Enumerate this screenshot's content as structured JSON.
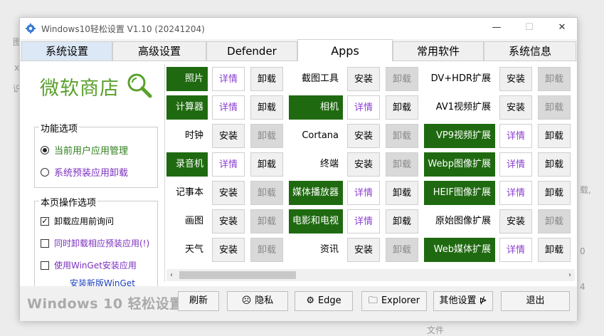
{
  "background_fragments": [
    "图",
    "x",
    "识",
    "载,",
    "0",
    "4",
    "文件"
  ],
  "window": {
    "title": "Windows10轻松设置 V1.10  (20241204)",
    "minimize": "—",
    "maximize": "☐",
    "close": "✕"
  },
  "tabs": [
    {
      "label": "系统设置"
    },
    {
      "label": "高级设置"
    },
    {
      "label": "Defender"
    },
    {
      "label": "Apps"
    },
    {
      "label": "常用软件"
    },
    {
      "label": "系统信息"
    }
  ],
  "sidebar": {
    "logo_text": "微软商店",
    "function_group": {
      "title": "功能选项",
      "options": [
        {
          "label": "当前用户应用管理",
          "selected": true
        },
        {
          "label": "系统预装应用卸载",
          "selected": false
        }
      ]
    },
    "page_group": {
      "title": "本页操作选项",
      "options": [
        {
          "label": "卸载应用前询问",
          "checked": true
        },
        {
          "label": "同时卸载相应预装应用(!)",
          "checked": false
        },
        {
          "label": "使用WinGet安装应用",
          "checked": false
        }
      ],
      "link": "安装新版WinGet"
    }
  },
  "apps": {
    "col1": [
      {
        "name": "照片",
        "installed": true
      },
      {
        "name": "计算器",
        "installed": true
      },
      {
        "name": "时钟",
        "installed": false
      },
      {
        "name": "录音机",
        "installed": true
      },
      {
        "name": "记事本",
        "installed": false
      },
      {
        "name": "画图",
        "installed": false
      },
      {
        "name": "天气",
        "installed": false
      }
    ],
    "col2": [
      {
        "name": "截图工具",
        "installed": false
      },
      {
        "name": "相机",
        "installed": true
      },
      {
        "name": "Cortana",
        "installed": false
      },
      {
        "name": "终端",
        "installed": false
      },
      {
        "name": "媒体播放器",
        "installed": true
      },
      {
        "name": "电影和电视",
        "installed": true
      },
      {
        "name": "资讯",
        "installed": false
      }
    ],
    "col3": [
      {
        "name": "DV+HDR扩展",
        "installed": false
      },
      {
        "name": "AV1视频扩展",
        "installed": false
      },
      {
        "name": "VP9视频扩展",
        "installed": true
      },
      {
        "name": "Webp图像扩展",
        "installed": true
      },
      {
        "name": "HEIF图像扩展",
        "installed": true
      },
      {
        "name": "原始图像扩展",
        "installed": false
      },
      {
        "name": "Web媒体扩展",
        "installed": true
      }
    ],
    "labels": {
      "detail": "详情",
      "install": "安装",
      "uninstall": "卸载"
    }
  },
  "scrollbar": {
    "left": "‹",
    "right": "›"
  },
  "bottom": {
    "title": "Windows 10 轻松设置",
    "buttons": [
      {
        "label": "刷新",
        "icon": ""
      },
      {
        "label": "隐私",
        "icon": "☹"
      },
      {
        "label": "Edge",
        "icon": "⚙"
      },
      {
        "label": "Explorer",
        "icon": "🗀"
      },
      {
        "label": "其他设置 ⋫",
        "icon": ""
      },
      {
        "label": "退出",
        "icon": ""
      }
    ]
  },
  "colors": {
    "installed_green": "#1f6a10",
    "logo_green": "#5aa12c",
    "detail_purple": "#8a3fd0"
  }
}
